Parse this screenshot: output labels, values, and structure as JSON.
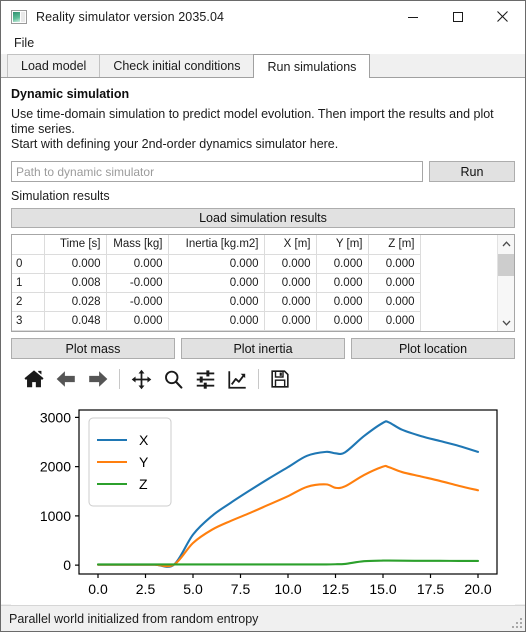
{
  "window": {
    "title": "Reality simulator version 2035.04",
    "icon": "app-icon",
    "minimize": "—",
    "maximize": "☐",
    "close": "✕"
  },
  "menubar": {
    "items": [
      {
        "label": "File"
      }
    ]
  },
  "tabs": [
    {
      "label": "Load model",
      "active": false
    },
    {
      "label": "Check initial conditions",
      "active": false
    },
    {
      "label": "Run simulations",
      "active": true
    }
  ],
  "main": {
    "heading": "Dynamic simulation",
    "description_line1": "Use time-domain simulation to predict model evolution. Then import the results and plot time series.",
    "description_line2": "Start with defining your 2nd-order dynamics simulator here.",
    "path_placeholder": "Path to dynamic simulator",
    "path_value": "",
    "run_label": "Run",
    "results_label": "Simulation results",
    "load_results_label": "Load simulation results"
  },
  "table": {
    "columns": [
      "Time [s]",
      "Mass [kg]",
      "Inertia [kg.m2]",
      "X [m]",
      "Y [m]",
      "Z [m]"
    ],
    "rows": [
      {
        "index": "0",
        "cells": [
          "0.000",
          "0.000",
          "0.000",
          "0.000",
          "0.000",
          "0.000"
        ]
      },
      {
        "index": "1",
        "cells": [
          "0.008",
          "-0.000",
          "0.000",
          "0.000",
          "0.000",
          "0.000"
        ]
      },
      {
        "index": "2",
        "cells": [
          "0.028",
          "-0.000",
          "0.000",
          "0.000",
          "0.000",
          "0.000"
        ]
      },
      {
        "index": "3",
        "cells": [
          "0.048",
          "0.000",
          "0.000",
          "0.000",
          "0.000",
          "0.000"
        ]
      }
    ],
    "scrollbar": {
      "up": "▲",
      "down": "▼"
    }
  },
  "plot_buttons": [
    {
      "label": "Plot mass"
    },
    {
      "label": "Plot inertia"
    },
    {
      "label": "Plot location"
    }
  ],
  "mpl_toolbar": [
    {
      "name": "home-icon"
    },
    {
      "name": "back-arrow-icon"
    },
    {
      "name": "forward-arrow-icon"
    },
    {
      "name": "separator"
    },
    {
      "name": "pan-move-icon"
    },
    {
      "name": "zoom-magnifier-icon"
    },
    {
      "name": "configure-subplots-icon"
    },
    {
      "name": "edit-axis-curves-icon"
    },
    {
      "name": "separator"
    },
    {
      "name": "save-figure-icon"
    }
  ],
  "statusbar": {
    "message": "Parallel world initialized from random entropy"
  },
  "chart_data": {
    "type": "line",
    "title": "",
    "xlabel": "",
    "ylabel": "",
    "xlim": [
      -1.0,
      21.0
    ],
    "ylim": [
      -180,
      3150
    ],
    "xticks": [
      "0.0",
      "2.5",
      "5.0",
      "7.5",
      "10.0",
      "12.5",
      "15.0",
      "17.5",
      "20.0"
    ],
    "xtick_values": [
      0.0,
      2.5,
      5.0,
      7.5,
      10.0,
      12.5,
      15.0,
      17.5,
      20.0
    ],
    "yticks": [
      "0",
      "1000",
      "2000",
      "3000"
    ],
    "ytick_values": [
      0,
      1000,
      2000,
      3000
    ],
    "grid": false,
    "legend_position": "upper left",
    "x": [
      0,
      1,
      2,
      3,
      4,
      5,
      6,
      7,
      8,
      9,
      10,
      11,
      12,
      12.5,
      13,
      14,
      15,
      15.3,
      16,
      17,
      18,
      19,
      20
    ],
    "series": [
      {
        "name": "X",
        "color": "#1f77b4",
        "values": [
          10,
          10,
          10,
          10,
          10,
          620,
          1000,
          1270,
          1520,
          1760,
          1990,
          2220,
          2300,
          2270,
          2290,
          2620,
          2890,
          2900,
          2750,
          2620,
          2520,
          2420,
          2300
        ]
      },
      {
        "name": "Y",
        "color": "#ff7f0e",
        "values": [
          10,
          10,
          10,
          10,
          10,
          450,
          720,
          900,
          1060,
          1230,
          1400,
          1590,
          1640,
          1570,
          1600,
          1830,
          2000,
          1990,
          1890,
          1800,
          1710,
          1610,
          1520
        ]
      },
      {
        "name": "Z",
        "color": "#2ca02c",
        "values": [
          15,
          15,
          15,
          15,
          15,
          15,
          15,
          15,
          15,
          15,
          15,
          15,
          15,
          18,
          25,
          80,
          92,
          92,
          90,
          88,
          87,
          86,
          85
        ]
      }
    ]
  }
}
